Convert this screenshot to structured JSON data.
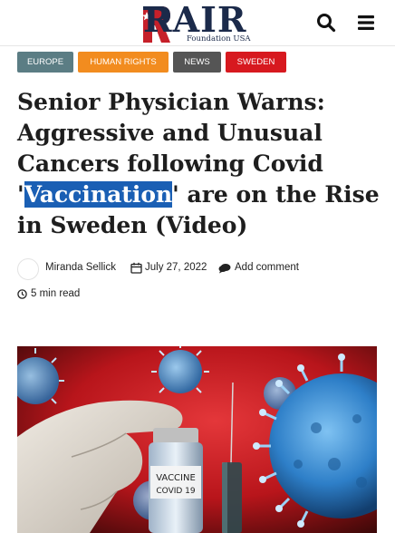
{
  "header": {
    "logo_main": "RAIR",
    "logo_sub": "Foundation USA",
    "icons": [
      "search-icon",
      "menu-icon"
    ]
  },
  "tags": [
    {
      "label": "EUROPE",
      "color": "#5b7d84"
    },
    {
      "label": "HUMAN RIGHTS",
      "color": "#f28c1f"
    },
    {
      "label": "NEWS",
      "color": "#555555"
    },
    {
      "label": "SWEDEN",
      "color": "#d7191f"
    }
  ],
  "article": {
    "title_before": "Senior Physician Warns: Aggressive and Unusual Cancers following Covid '",
    "title_highlight": "Vaccination",
    "title_after": "' are on the Rise in Sweden (Video)",
    "author": "Miranda Sellick",
    "date": "July 27, 2022",
    "comment_link": "Add comment",
    "read_time": "5 min read"
  },
  "image": {
    "vial_text_1": "VACCINE",
    "vial_text_2": "COVID 19",
    "colors": {
      "background": "#c4161c",
      "virus": "#2e7fc8"
    }
  },
  "colors": {
    "highlight": "#1a5fb4",
    "brand": "#1b2a4a"
  }
}
